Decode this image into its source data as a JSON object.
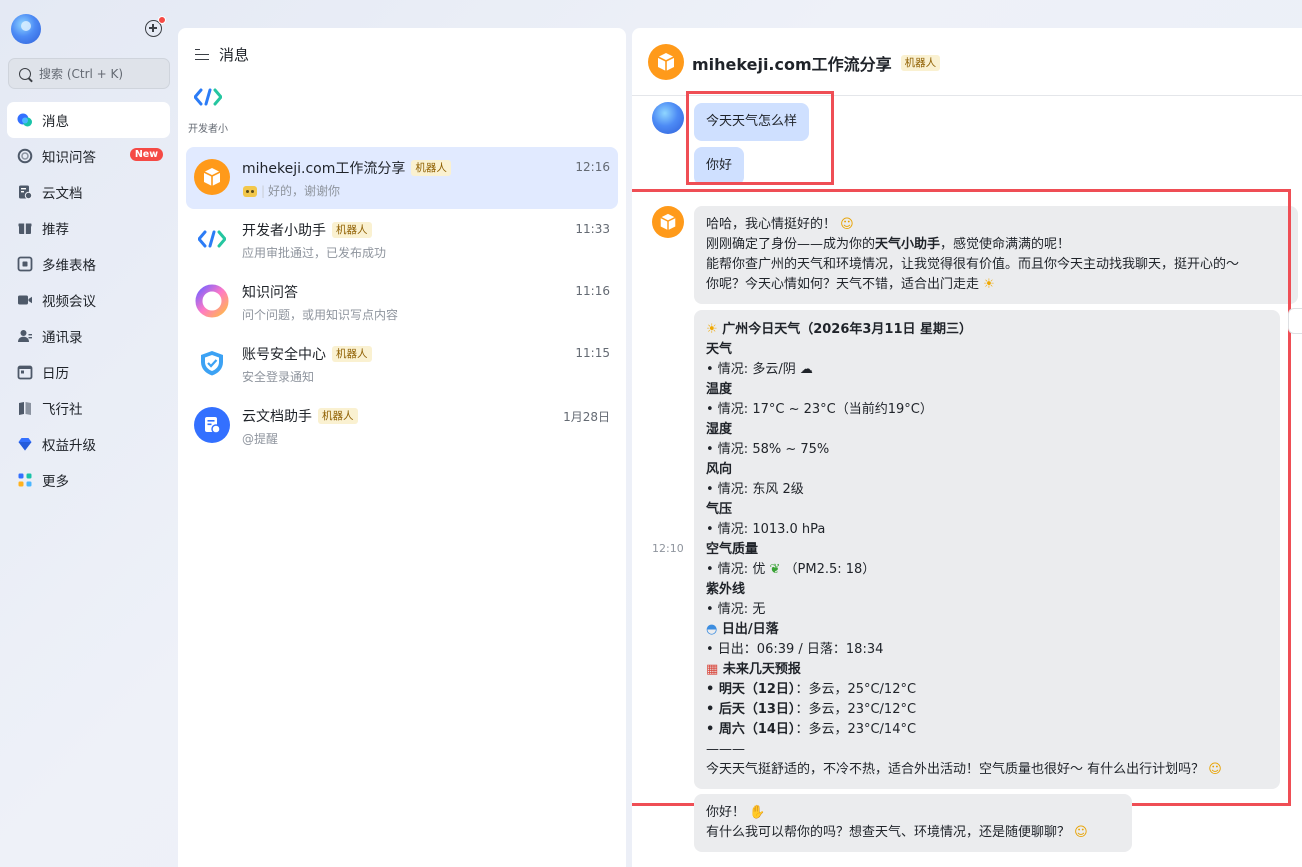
{
  "nav": {
    "search_placeholder": "搜索 (Ctrl + K)",
    "items": [
      {
        "label": "消息",
        "icon": "chat-bubbles-icon"
      },
      {
        "label": "知识问答",
        "icon": "knowledge-ring-icon",
        "badge": "New"
      },
      {
        "label": "云文档",
        "icon": "cloud-doc-icon"
      },
      {
        "label": "推荐",
        "icon": "gift-icon"
      },
      {
        "label": "多维表格",
        "icon": "grid-table-icon"
      },
      {
        "label": "视频会议",
        "icon": "video-camera-icon"
      },
      {
        "label": "通讯录",
        "icon": "contacts-icon"
      },
      {
        "label": "日历",
        "icon": "calendar-icon"
      },
      {
        "label": "飞行社",
        "icon": "book-icon"
      },
      {
        "label": "权益升级",
        "icon": "diamond-icon"
      },
      {
        "label": "更多",
        "icon": "apps-grid-icon"
      }
    ]
  },
  "convs": {
    "header": "消息",
    "pinned_label": "开发者小",
    "items": [
      {
        "name": "mihekeji.com工作流分享",
        "tag": "机器人",
        "time": "12:16",
        "preview": "好的，谢谢你",
        "avatar": "orange-box-avatar"
      },
      {
        "name": "开发者小助手",
        "tag": "机器人",
        "time": "11:33",
        "preview": "应用审批通过，已发布成功",
        "avatar": "dev-code-avatar"
      },
      {
        "name": "知识问答",
        "tag": "",
        "time": "11:16",
        "preview": "问个问题，或用知识写点内容",
        "avatar": "ring-avatar"
      },
      {
        "name": "账号安全中心",
        "tag": "机器人",
        "time": "11:15",
        "preview": "安全登录通知",
        "avatar": "shield-avatar"
      },
      {
        "name": "云文档助手",
        "tag": "机器人",
        "time": "1月28日",
        "preview": "@提醒",
        "avatar": "doc-avatar"
      }
    ]
  },
  "chat": {
    "title": "mihekeji.com工作流分享",
    "tag": "机器人",
    "user_msg1": "今天天气怎么样",
    "user_msg2": "你好",
    "time": "12:10",
    "bot_msg1": {
      "l1": "哈哈，我心情挺好的！",
      "l2a": "刚刚确定了身份——成为你的",
      "l2b": "天气小助手",
      "l2c": "，感觉使命满满的呢！",
      "l3": "能帮你查广州的天气和环境情况，让我觉得很有价值。而且你今天主动找我聊天，挺开心的～",
      "l4": "你呢？今天心情如何？天气不错，适合出门走走"
    },
    "weather": {
      "title": "广州今日天气（2026年3月11日 星期三）",
      "sections": [
        {
          "h": "天气",
          "v": "• 情况: 多云/阴"
        },
        {
          "h": "温度",
          "v": "• 情况: 17°C ~ 23°C（当前约19°C）"
        },
        {
          "h": "湿度",
          "v": "• 情况: 58% ~ 75%"
        },
        {
          "h": "风向",
          "v": "• 情况: 东风 2级"
        },
        {
          "h": "气压",
          "v": "• 情况: 1013.0 hPa"
        },
        {
          "h": "空气质量",
          "v": "• 情况: 优",
          "v2": "（PM2.5: 18）"
        },
        {
          "h": "紫外线",
          "v": "• 情况: 无"
        }
      ],
      "sun_h": "日出/日落",
      "sun_v": "• 日出：06:39 / 日落：18:34",
      "forecast_h": "未来几天预报",
      "forecast": [
        {
          "d": "• 明天（12日）",
          "v": "：多云，25°C/12°C"
        },
        {
          "d": "• 后天（13日）",
          "v": "：多云，23°C/12°C"
        },
        {
          "d": "• 周六（14日）",
          "v": "：多云，23°C/14°C"
        }
      ],
      "divider": "———",
      "closing": "今天天气挺舒适的，不冷不热，适合外出活动！空气质量也很好～ 有什么出行计划吗？"
    },
    "bot_msg3": {
      "l1": "你好！",
      "l2": "有什么我可以帮你的吗？想查天气、环境情况，还是随便聊聊？"
    }
  },
  "colors": {
    "accent": "#3370ff",
    "highlight_border": "#ef4e55",
    "bot_tag_bg": "#faf1d1",
    "active_conv": "#e1eaff"
  }
}
